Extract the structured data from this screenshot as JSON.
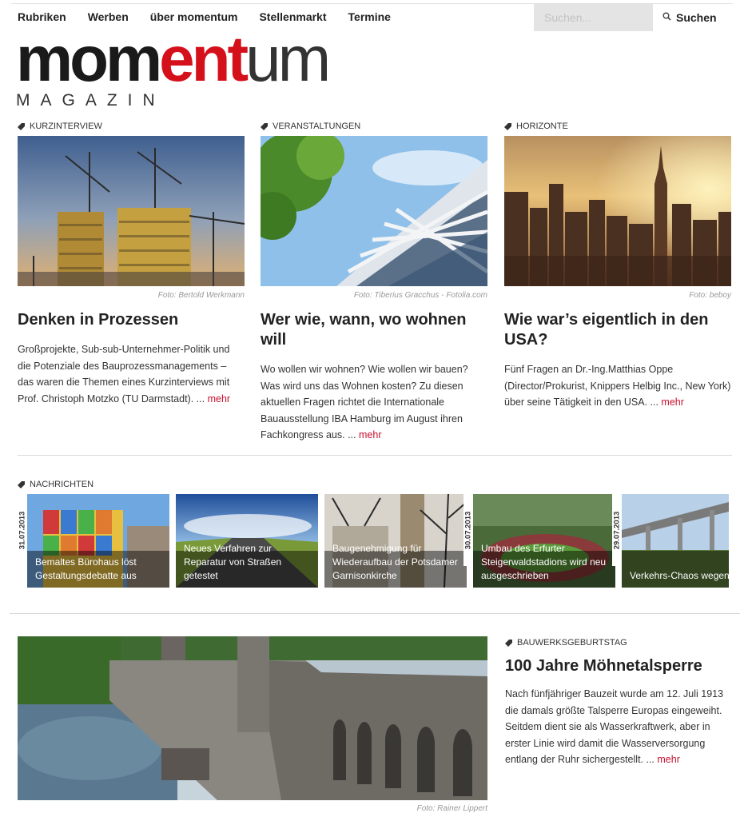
{
  "nav": {
    "items": [
      "Rubriken",
      "Werben",
      "über momentum",
      "Stellenmarkt",
      "Termine"
    ]
  },
  "search": {
    "placeholder": "Suchen...",
    "button_label": "Suchen",
    "icon": "search-icon"
  },
  "logo": {
    "part1": "mom",
    "part2": "ent",
    "part3": "um",
    "subtitle": "MAGAZIN"
  },
  "colors": {
    "accent": "#d4101b",
    "link": "#c8102e"
  },
  "features": [
    {
      "category": "KURZINTERVIEW",
      "credit": "Foto: Bertold Werkmann",
      "title": "Denken in Prozessen",
      "text": "Großprojekte, Sub-sub-Unternehmer-Politik und die Potenziale des Bauprozessmanagements – das waren die Themen eines Kurzinterviews mit Prof. Christoph Motzko (TU Darmstadt). ...",
      "more": "mehr"
    },
    {
      "category": "VERANSTALTUNGEN",
      "credit": "Foto: Tiberius Gracchus - Fotolia.com",
      "title": "Wer wie, wann, wo wohnen will",
      "text": "Wo wollen wir wohnen? Wie wollen wir bauen? Was wird uns das Wohnen kosten? Zu diesen aktuellen Fragen richtet die Internationale Bauausstellung IBA Hamburg im August ihren Fachkongress aus. ...",
      "more": "mehr"
    },
    {
      "category": "HORIZONTE",
      "credit": "Foto: beboy",
      "title": "Wie war’s eigentlich in den USA?",
      "text": "Fünf Fragen an Dr.-Ing.Matthias Oppe (Director/Prokurist, Knippers Helbig Inc., New York) über seine Tätigkeit in den USA. ...",
      "more": "mehr"
    }
  ],
  "news": {
    "category": "NACHRICHTEN",
    "dates": [
      "31.07.2013",
      "30.07.2013",
      "29.07.2013"
    ],
    "items": [
      "Bemaltes Bürohaus löst Gestaltungsdebatte aus",
      "Neues Verfahren zur Reparatur von Straßen getestet",
      "Baugenehmigung für Wiederaufbau der Potsdamer Garnisonkirche",
      "Umbau des Erfurter Steigerwaldstadions wird neu ausgeschrieben",
      "Verkehrs-Chaos wegen Bauarbeiten an wichtiger Brücke im Norden"
    ]
  },
  "bottom": {
    "category": "BAUWERKSGEBURTSTAG",
    "title": "100 Jahre Möhnetalsperre",
    "text": "Nach fünfjähriger Bauzeit wurde am 12. Juli 1913 die damals größte Talsperre Europas eingeweiht. Seitdem dient sie als Wasserkraftwerk, aber in erster Linie wird damit die Wasserversorgung entlang der Ruhr sichergestellt. ...",
    "more": "mehr",
    "credit": "Foto: Rainer Lippert"
  }
}
